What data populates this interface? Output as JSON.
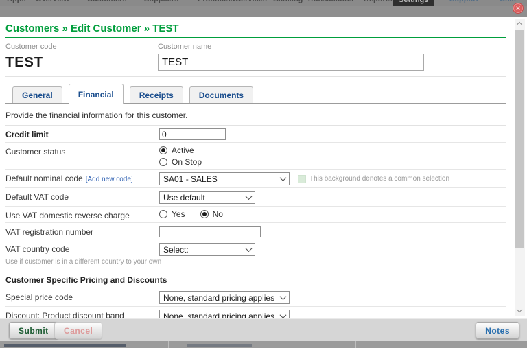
{
  "overlay": {
    "nav": [
      "Apps",
      "Overview",
      "Customers",
      "Suppliers",
      "Products&Services",
      "Banking",
      "Transactions",
      "Reports",
      "Settings",
      "Support",
      "Chat"
    ],
    "close_icon": "✕"
  },
  "modal": {
    "title": "Customers » Edit Customer » TEST",
    "header": {
      "code_label": "Customer code",
      "code_value": "TEST",
      "name_label": "Customer name",
      "name_value": "TEST"
    },
    "tabs": [
      {
        "label": "General",
        "active": false
      },
      {
        "label": "Financial",
        "active": true
      },
      {
        "label": "Receipts",
        "active": false
      },
      {
        "label": "Documents",
        "active": false
      }
    ],
    "intro": "Provide the financial information for this customer.",
    "fields": {
      "credit_limit": {
        "label": "Credit limit",
        "value": "0"
      },
      "customer_status": {
        "label": "Customer status",
        "options": [
          "Active",
          "On Stop"
        ],
        "selected": "Active"
      },
      "default_nominal_code": {
        "label": "Default nominal code",
        "add_link": "[Add new code]",
        "value": "SA01 - SALES",
        "legend": "This background denotes a common selection"
      },
      "default_vat_code": {
        "label": "Default VAT code",
        "value": "Use default"
      },
      "vat_reverse_charge": {
        "label": "Use VAT domestic reverse charge",
        "options": [
          "Yes",
          "No"
        ],
        "selected": "No"
      },
      "vat_registration_number": {
        "label": "VAT registration number",
        "value": ""
      },
      "vat_country_code": {
        "label": "VAT country code",
        "value": "Select:",
        "hint": "Use if customer is in a different country to your own"
      }
    },
    "pricing_section": {
      "title": "Customer Specific Pricing and Discounts",
      "special_price_code": {
        "label": "Special price code",
        "value": "None, standard pricing applies"
      },
      "product_discount_band": {
        "label": "Discount: Product discount band",
        "value": "None, standard pricing applies"
      }
    },
    "footer": {
      "submit": "Submit",
      "cancel": "Cancel",
      "notes": "Notes"
    }
  },
  "colors": {
    "accent_green": "#009e3c",
    "tab_blue": "#1b4e8e",
    "link_blue": "#2a5db0",
    "common_selection_green": "#d9ebd9",
    "close_red": "#dd5e5e",
    "submit_green": "#1d5c33",
    "cancel_pink": "#dd9a9a",
    "notes_blue": "#2a6fae"
  }
}
